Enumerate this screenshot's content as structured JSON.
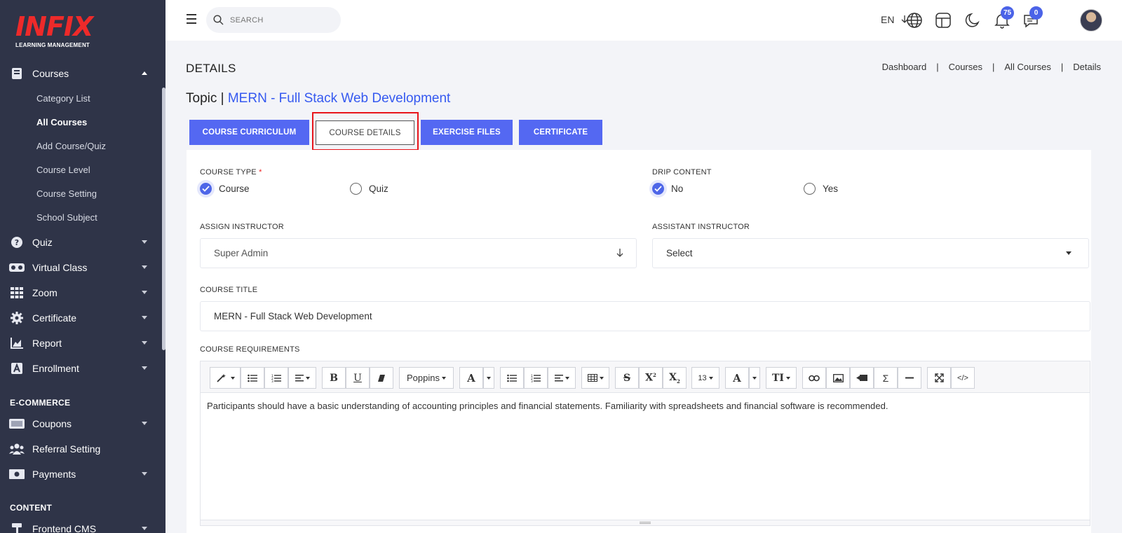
{
  "app": {
    "logo_text": "INFIX",
    "logo_subtitle": "LEARNING MANAGEMENT"
  },
  "sidebar": {
    "courses": {
      "label": "Courses",
      "icon": "book-icon",
      "expanded": true
    },
    "course_subitems": [
      {
        "label": "Category List",
        "active": false
      },
      {
        "label": "All Courses",
        "active": true
      },
      {
        "label": "Add Course/Quiz",
        "active": false
      },
      {
        "label": "Course Level",
        "active": false
      },
      {
        "label": "Course Setting",
        "active": false
      },
      {
        "label": "School Subject",
        "active": false
      }
    ],
    "items": [
      {
        "label": "Quiz",
        "icon": "question-icon"
      },
      {
        "label": "Virtual Class",
        "icon": "vr-icon"
      },
      {
        "label": "Zoom",
        "icon": "grid-icon"
      },
      {
        "label": "Certificate",
        "icon": "gear-icon"
      },
      {
        "label": "Report",
        "icon": "chart-icon"
      },
      {
        "label": "Enrollment",
        "icon": "enroll-icon"
      }
    ],
    "ecommerce_title": "E-COMMERCE",
    "ecommerce_items": [
      {
        "label": "Coupons",
        "icon": "coupon-icon"
      },
      {
        "label": "Referral Setting",
        "icon": "users-icon"
      },
      {
        "label": "Payments",
        "icon": "money-icon"
      }
    ],
    "content_title": "CONTENT",
    "content_items": [
      {
        "label": "Frontend CMS",
        "icon": "paint-icon"
      }
    ]
  },
  "topbar": {
    "search_placeholder": "SEARCH",
    "language": "EN",
    "notifications_count": "75",
    "messages_count": "0",
    "accent": "#4b63e8"
  },
  "page": {
    "title": "DETAILS",
    "breadcrumb": [
      "Dashboard",
      "Courses",
      "All Courses",
      "Details"
    ],
    "topic_prefix": "Topic |",
    "topic_name": "MERN - Full Stack Web Development"
  },
  "tabs": [
    {
      "label": "COURSE CURRICULUM",
      "active": false
    },
    {
      "label": "COURSE DETAILS",
      "active": true
    },
    {
      "label": "EXERCISE FILES",
      "active": false
    },
    {
      "label": "CERTIFICATE",
      "active": false
    }
  ],
  "form": {
    "course_type_label": "COURSE TYPE",
    "course_type_required": "*",
    "course_type_options": [
      "Course",
      "Quiz"
    ],
    "course_type_selected": "Course",
    "drip_content_label": "DRIP CONTENT",
    "drip_content_options": [
      "No",
      "Yes"
    ],
    "drip_content_selected": "No",
    "assign_instructor_label": "ASSIGN INSTRUCTOR",
    "assign_instructor_value": "Super Admin",
    "assistant_instructor_label": "ASSISTANT INSTRUCTOR",
    "assistant_instructor_value": "Select",
    "course_title_label": "COURSE TITLE",
    "course_title_value": "MERN - Full Stack Web Development",
    "course_requirements_label": "COURSE REQUIREMENTS"
  },
  "editor": {
    "font_name": "Poppins",
    "font_size": "13",
    "content": "Participants should have a basic understanding of accounting principles and financial statements. Familiarity with spreadsheets and financial software is recommended."
  }
}
